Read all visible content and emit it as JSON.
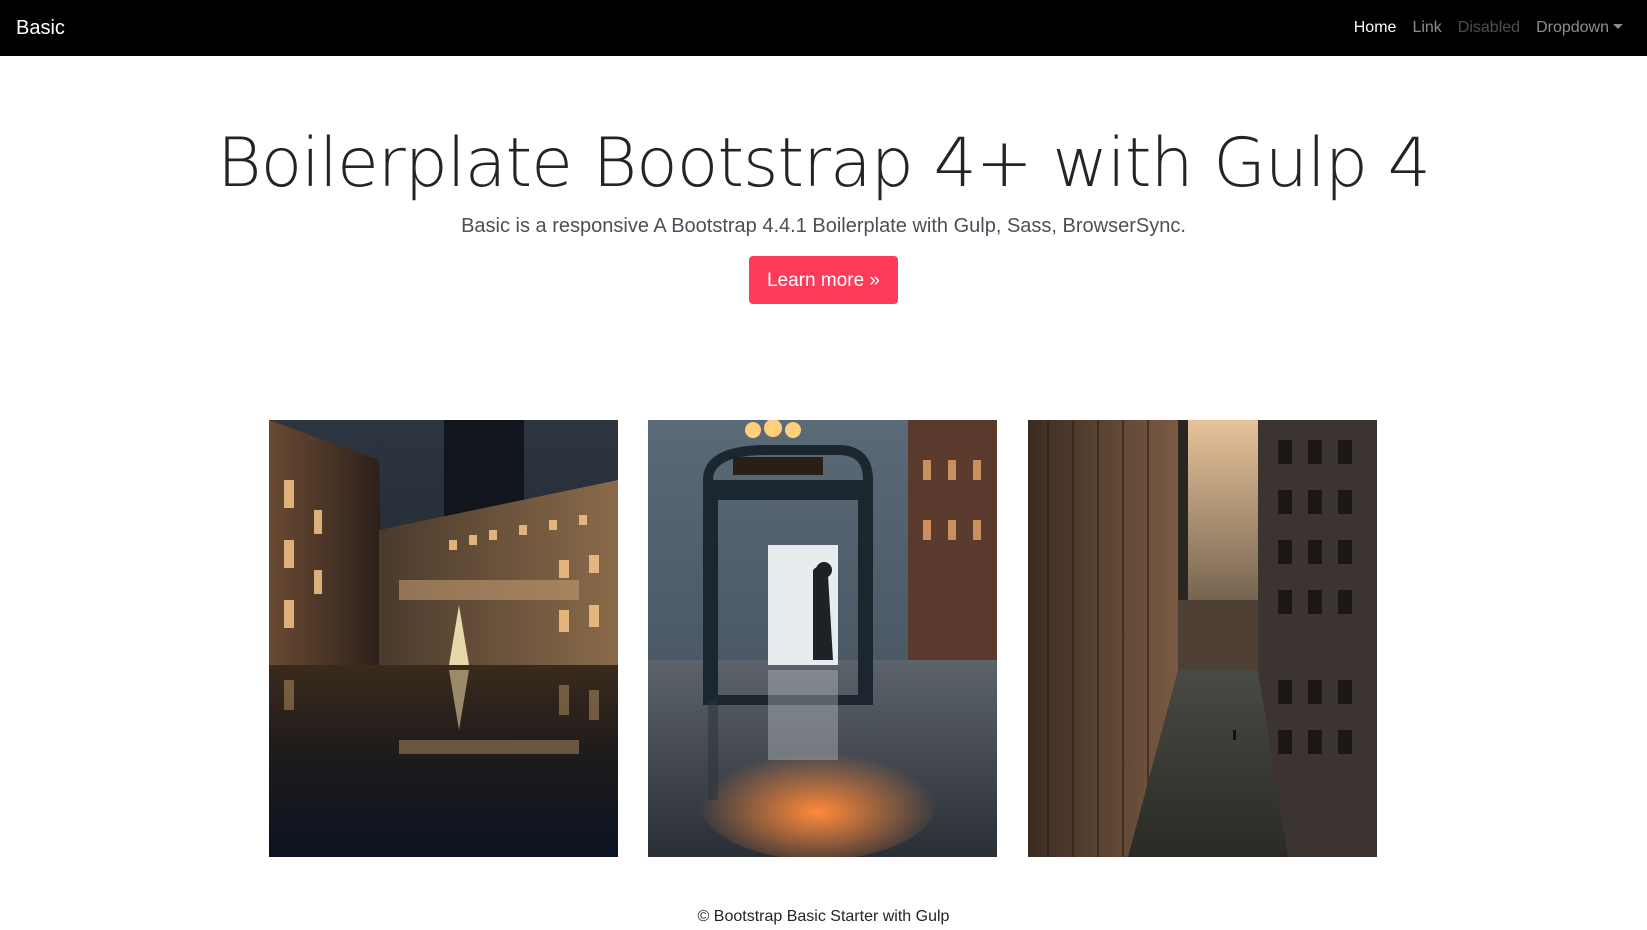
{
  "navbar": {
    "brand": "Basic",
    "items": [
      {
        "label": "Home",
        "state": "active"
      },
      {
        "label": "Link",
        "state": "normal"
      },
      {
        "label": "Disabled",
        "state": "disabled"
      },
      {
        "label": "Dropdown",
        "state": "dropdown"
      }
    ]
  },
  "hero": {
    "title": "Boilerplate Bootstrap 4+ with Gulp 4",
    "lead": "Basic is a responsive A Bootstrap 4.4.1 Boilerplate with Gulp, Sass, BrowserSync.",
    "button_label": "Learn more »"
  },
  "gallery": {
    "images": [
      "city-night-reflection-photo",
      "bus-stop-night-photo",
      "city-canyon-buildings-photo"
    ]
  },
  "footer": {
    "text": "© Bootstrap Basic Starter with Gulp"
  },
  "colors": {
    "navbar_bg": "#000000",
    "accent": "#ff3a5a",
    "text": "#212529"
  },
  "icons": {
    "dropdown": "caret-down-icon"
  }
}
